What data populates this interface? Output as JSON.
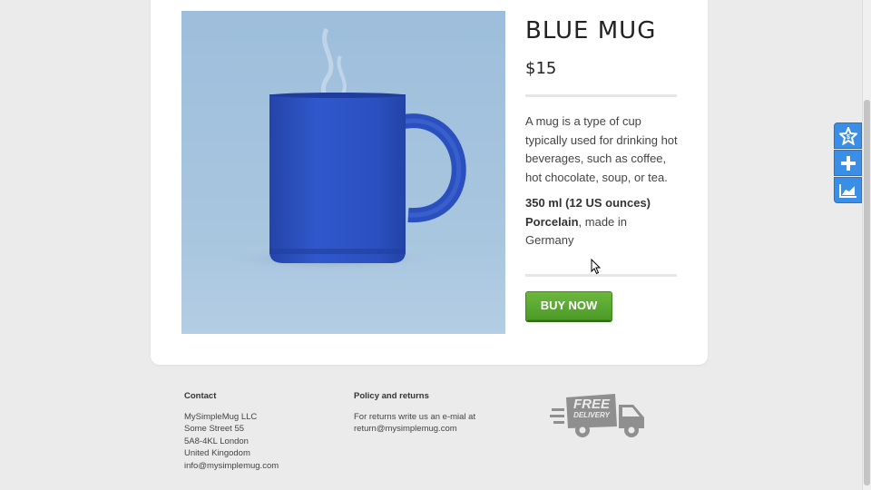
{
  "product": {
    "title": "BLUE MUG",
    "price": "$15",
    "description": "A mug is a type of cup typically used for drinking hot beverages, such as coffee, hot chocolate, soup, or tea.",
    "volume": "350 ml (12 US ounces)",
    "material": "Porcelain",
    "origin": ", made in Germany",
    "buy_label": "BUY NOW",
    "image_icon": "blue-mug-photo"
  },
  "footer": {
    "contact": {
      "heading": "Contact",
      "lines": [
        "MySimpleMug LLC",
        "Some Street 55",
        "5A8-4KL London",
        "United Kingodom",
        "info@mysimplemug.com"
      ]
    },
    "policy": {
      "heading": "Policy and returns",
      "lines": [
        "For returns write us an e-mial at",
        "return@mysimplemug.com"
      ]
    },
    "delivery_badge": {
      "line1": "FREE",
      "line2": "DELIVERY",
      "icon": "truck-icon"
    }
  },
  "widgets": [
    {
      "icon": "star-badge-icon"
    },
    {
      "icon": "plus-icon"
    },
    {
      "icon": "chart-icon"
    }
  ],
  "colors": {
    "accent_green": "#5aa932",
    "widget_blue": "#3a8ee6",
    "mug_blue": "#2e53c4",
    "photo_bg": "#a7c5de"
  }
}
